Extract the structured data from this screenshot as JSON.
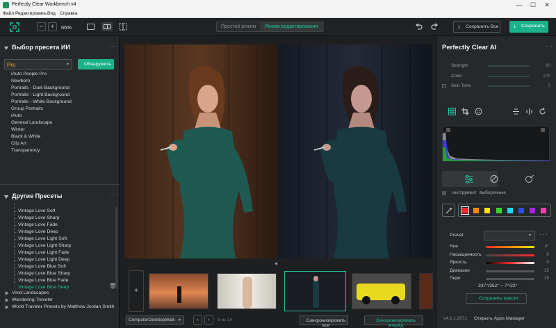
{
  "window": {
    "title": "Perfectly Clear Workbench v4",
    "minimize": "—",
    "maximize": "☐",
    "close": "✕"
  },
  "menu": [
    "Файл",
    "Редактировать",
    "Вид",
    "Справка"
  ],
  "toolbar": {
    "zoom_minus": "−",
    "zoom_plus": "+",
    "zoom_value": "66%",
    "mode_simple": "Простой режим",
    "mode_edit": "Режим редактирования",
    "save_all": "Сохранить Все",
    "save": "Сохранить"
  },
  "left": {
    "ai_title": "Выбор пресета ИИ",
    "preset_value": "Pro",
    "detect_button": "Обнаружить",
    "ai_presets": [
      "iAuto People Pro",
      "Newborn",
      "Portraits - Dark Background",
      "Portraits - Light Background",
      "Portraits - White Background",
      "Group Portraits",
      "iAuto",
      "General Landscape",
      "Winter",
      "Black & White",
      "Clip Art",
      "Transparency"
    ],
    "other_title": "Другие Пресеты",
    "vintage": [
      "Vintage Love Soft",
      "Vintage Love Sharp",
      "Vintage Love Fade",
      "Vintage Love Deep",
      "Vintage Love Light Soft",
      "Vintage Love Light Sharp",
      "Vintage Love Light Fade",
      "Vintage Love Light Deep",
      "Vintage Love Blue Soft",
      "Vintage Love Blue Sharp",
      "Vintage Love Blue Fade",
      "Vintage Love Blue Deep"
    ],
    "active_preset": "Vintage Love Blue Deep",
    "groups": [
      "Vivid Landscapes",
      "Wandering Traveler",
      "World Traveler Presets by Matthew Jordan Smith"
    ]
  },
  "status": {
    "folder": "ComputerDesktopWalk",
    "counter": "8 из 14",
    "sync_all": "Синхронизировать все",
    "sync_forward": "Синхронизировать вперёд"
  },
  "right": {
    "title": "Perfectly Clear AI",
    "sliders": [
      {
        "label": "Strength",
        "value": "80"
      },
      {
        "label": "Color",
        "value": "100"
      },
      {
        "label": "Skin Tone",
        "value": "0"
      }
    ],
    "tool_label": "инструмент",
    "selection_label": "выборочные",
    "swatch_colors": [
      "#ff2a2a",
      "#ff8a00",
      "#ffe600",
      "#3ad62e",
      "#22d8f0",
      "#2b4cff",
      "#b020e8",
      "#ff3fb0"
    ],
    "preset_label": "Preset",
    "adjust": [
      {
        "label": "Hue",
        "value": "0°"
      },
      {
        "label": "Насыщенность",
        "value": "0"
      },
      {
        "label": "Яркость",
        "value": "0"
      },
      {
        "label": "Диапазон",
        "value": "15"
      },
      {
        "label": "Перо",
        "value": "15"
      }
    ],
    "angle_readout": "337°/352° ~ 7°/22°",
    "save_preset": "Сохранить пресет",
    "version": "v4.6.1.2671",
    "apps_manager": "Открыть Apps Manager"
  }
}
